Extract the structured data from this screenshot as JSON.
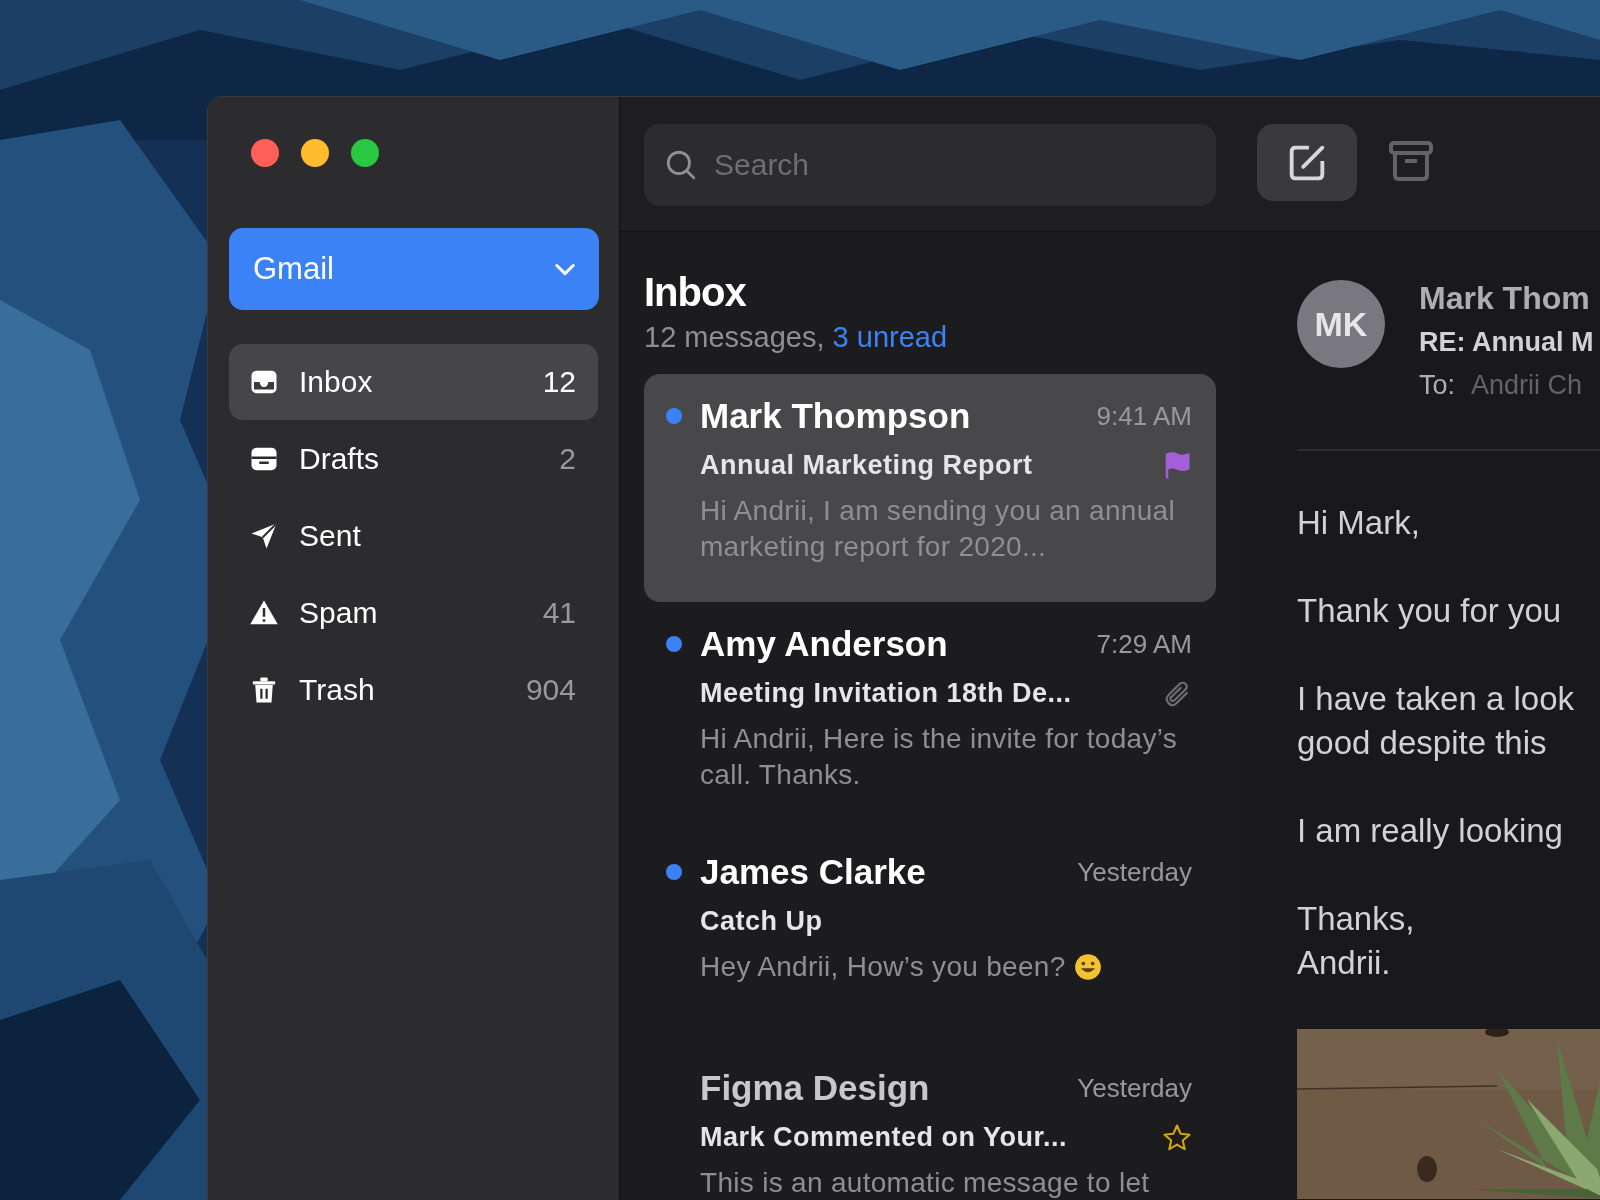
{
  "window": {
    "controls": [
      {
        "kind": "close"
      },
      {
        "kind": "minimize"
      },
      {
        "kind": "zoom"
      }
    ]
  },
  "sidebar": {
    "account": "Gmail",
    "items": [
      {
        "kind": "inbox",
        "label": "Inbox",
        "count": "12",
        "selected": true
      },
      {
        "kind": "drafts",
        "label": "Drafts",
        "count": "2",
        "selected": false
      },
      {
        "kind": "sent",
        "label": "Sent",
        "selected": false
      },
      {
        "kind": "spam",
        "label": "Spam",
        "count": "41",
        "selected": false
      },
      {
        "kind": "trash",
        "label": "Trash",
        "count": "904",
        "selected": false
      }
    ]
  },
  "search": {
    "placeholder": "Search"
  },
  "mailbox": {
    "title": "Inbox",
    "summary": "12 messages,",
    "unread": "3 unread"
  },
  "messages": [
    {
      "sender": "Mark Thompson",
      "time": "9:41 AM",
      "subject": "Annual Marketing Report",
      "preview": "Hi Andrii, I am sending you an annual marketing report for 2020...",
      "unread": true,
      "selected": true,
      "flagged": true,
      "attachment": false,
      "starred": false,
      "emoji": false
    },
    {
      "sender": "Amy Anderson",
      "time": "7:29 AM",
      "subject": "Meeting Invitation 18th De...",
      "preview": "Hi Andrii, Here is the invite for today’s call. Thanks.",
      "unread": true,
      "selected": false,
      "flagged": false,
      "attachment": true,
      "starred": false,
      "emoji": false
    },
    {
      "sender": "James Clarke",
      "time": "Yesterday",
      "subject": "Catch Up",
      "preview": "Hey Andrii, How’s you been?",
      "unread": true,
      "selected": false,
      "flagged": false,
      "attachment": false,
      "starred": false,
      "emoji": true
    },
    {
      "sender": "Figma Design",
      "time": "Yesterday",
      "subject": "Mark Commented on Your...",
      "preview": "This is an automatic message to let",
      "unread": false,
      "selected": false,
      "flagged": false,
      "attachment": false,
      "starred": true,
      "emoji": false
    }
  ],
  "reader": {
    "initials": "MK",
    "sender": "Mark Thom",
    "subject": "RE: Annual M",
    "to_label": "To:",
    "to": "Andrii Ch",
    "body": [
      [
        "Hi Mark,"
      ],
      [
        "Thank you for you"
      ],
      [
        "I have taken a look",
        "good despite this"
      ],
      [
        "I am really looking"
      ],
      [
        "Thanks,",
        "Andrii."
      ]
    ],
    "attachment": {
      "kind": "picture"
    }
  }
}
